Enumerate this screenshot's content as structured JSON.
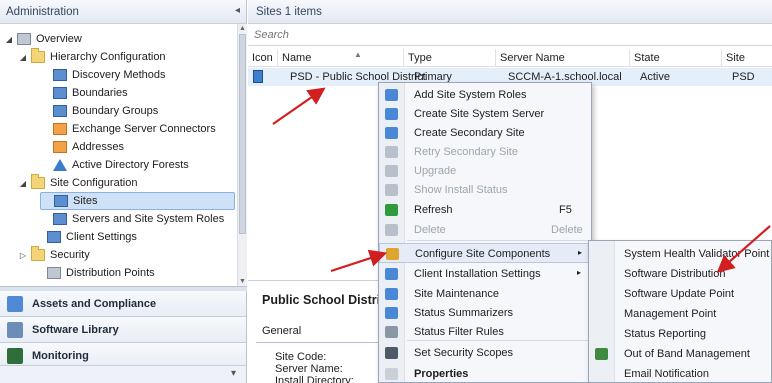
{
  "nav": {
    "header": "Administration",
    "collapse_glyph": "◂",
    "tree": [
      {
        "label": "Overview",
        "expander": "◢",
        "icon": "overview-icon",
        "icon_class": "gray"
      },
      {
        "label": "Hierarchy Configuration",
        "expander": "◢",
        "icon": "folder-icon",
        "icon_class": "folder"
      },
      {
        "label": "Discovery Methods",
        "expander": "",
        "icon": "discovery-icon",
        "icon_class": "blue"
      },
      {
        "label": "Boundaries",
        "expander": "",
        "icon": "boundaries-icon",
        "icon_class": "blue"
      },
      {
        "label": "Boundary Groups",
        "expander": "",
        "icon": "boundary-groups-icon",
        "icon_class": "blue"
      },
      {
        "label": "Exchange Server Connectors",
        "expander": "",
        "icon": "exchange-icon",
        "icon_class": "orange"
      },
      {
        "label": "Addresses",
        "expander": "",
        "icon": "addresses-icon",
        "icon_class": "orange"
      },
      {
        "label": "Active Directory Forests",
        "expander": "",
        "icon": "forest-icon",
        "icon_class": "tri"
      },
      {
        "label": "Site Configuration",
        "expander": "◢",
        "icon": "folder-icon",
        "icon_class": "folder"
      },
      {
        "label": "Sites",
        "expander": "",
        "icon": "sites-icon",
        "icon_class": "blue",
        "selected": true
      },
      {
        "label": "Servers and Site System Roles",
        "expander": "",
        "icon": "servers-icon",
        "icon_class": "blue"
      },
      {
        "label": "Client Settings",
        "expander": "",
        "icon": "client-settings-icon",
        "icon_class": "blue"
      },
      {
        "label": "Security",
        "expander": "▷",
        "icon": "folder-icon",
        "icon_class": "folder"
      },
      {
        "label": "Distribution Points",
        "expander": "",
        "icon": "distribution-points-icon",
        "icon_class": "gray"
      }
    ],
    "workspaces": [
      {
        "label": "Assets and Compliance",
        "icon": "assets-icon",
        "color": "#4f8bd4"
      },
      {
        "label": "Software Library",
        "icon": "software-library-icon",
        "color": "#6c8db8"
      },
      {
        "label": "Monitoring",
        "icon": "monitoring-icon",
        "color": "#2f6e3a"
      }
    ],
    "more_glyph": "▾"
  },
  "main": {
    "header": "Sites 1 items",
    "search": {
      "placeholder": "Search",
      "value": ""
    },
    "columns": [
      "Icon",
      "Name",
      "Type",
      "Server Name",
      "State",
      "Site Code"
    ],
    "rows": [
      {
        "name": "PSD - Public School District",
        "type": "Primary",
        "server": "SCCM-A-1.school.local",
        "state": "Active",
        "site_code": "PSD"
      }
    ],
    "details": {
      "title": "Public School District",
      "tab": "General",
      "labels": [
        "Site Code:",
        "Server Name:",
        "Install Directory:"
      ]
    }
  },
  "context_menu": {
    "items": [
      {
        "label": "Add Site System Roles",
        "icon": "add-roles-icon",
        "color": "#4a88d6",
        "disabled": false
      },
      {
        "label": "Create Site System Server",
        "icon": "create-server-icon",
        "color": "#4a88d6",
        "disabled": false
      },
      {
        "label": "Create Secondary Site",
        "icon": "secondary-site-icon",
        "color": "#4a88d6",
        "disabled": false
      },
      {
        "label": "Retry Secondary Site",
        "icon": "retry-icon",
        "color": "#b8c0cb",
        "disabled": true
      },
      {
        "label": "Upgrade",
        "icon": "upgrade-icon",
        "color": "#b8c0cb",
        "disabled": true
      },
      {
        "label": "Show Install Status",
        "icon": "install-status-icon",
        "color": "#b8c0cb",
        "disabled": true
      },
      {
        "label": "Refresh",
        "icon": "refresh-icon",
        "color": "#2e9a3a",
        "disabled": false,
        "shortcut": "F5"
      },
      {
        "label": "Delete",
        "icon": "delete-icon",
        "color": "#b8c0cb",
        "disabled": true,
        "shortcut": "Delete"
      },
      {
        "label": "Configure Site Components",
        "icon": "configure-icon",
        "color": "#e0a431",
        "disabled": false,
        "submenu": true,
        "highlight": true
      },
      {
        "label": "Client Installation Settings",
        "icon": "client-install-icon",
        "color": "#4a88d6",
        "disabled": false,
        "submenu": true
      },
      {
        "label": "Site Maintenance",
        "icon": "maintenance-icon",
        "color": "#4a88d6",
        "disabled": false
      },
      {
        "label": "Status Summarizers",
        "icon": "summarizers-icon",
        "color": "#4a88d6",
        "disabled": false
      },
      {
        "label": "Status Filter Rules",
        "icon": "filter-icon",
        "color": "#8b96a6",
        "disabled": false
      },
      {
        "label": "Set Security Scopes",
        "icon": "security-scopes-icon",
        "color": "#4d5a6a",
        "disabled": false
      },
      {
        "label": "Properties",
        "icon": "properties-icon",
        "color": "#c9d0da",
        "disabled": false,
        "bold": true
      }
    ]
  },
  "submenu": {
    "items": [
      {
        "label": "System Health Validator Point"
      },
      {
        "label": "Software Distribution"
      },
      {
        "label": "Software Update Point"
      },
      {
        "label": "Management Point"
      },
      {
        "label": "Status Reporting"
      },
      {
        "label": "Out of Band Management",
        "icon": "out-of-band-icon",
        "color": "#3f8a3f"
      },
      {
        "label": "Email Notification"
      }
    ]
  },
  "submenu_glyph": "▸",
  "annotation_color": "#d11f1f"
}
